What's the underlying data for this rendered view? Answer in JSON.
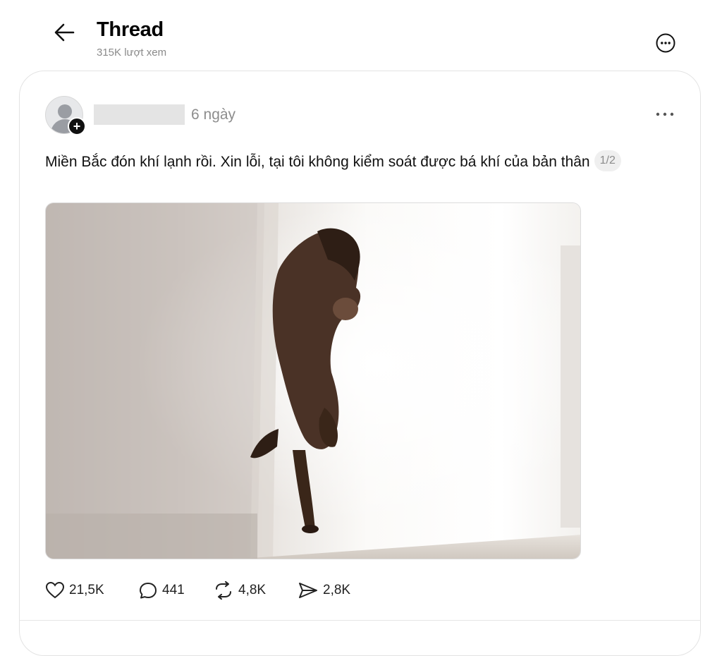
{
  "header": {
    "title": "Thread",
    "views": "315K lượt xem"
  },
  "post": {
    "time": "6 ngày",
    "text": "Miền Bắc đón khí lạnh rồi. Xin lỗi, tại tôi không kiểm soát được bá khí của bản thân",
    "page_indicator": "1/2",
    "image_description_icon": "photo",
    "actions": {
      "likes": "21,5K",
      "comments": "441",
      "reposts": "4,8K",
      "shares": "2,8K"
    }
  },
  "icons": {
    "back": "arrow-left-icon",
    "more_circle": "more-circle-icon",
    "dots": "ellipsis-icon",
    "like": "heart-icon",
    "comment": "comment-icon",
    "repost": "repost-icon",
    "share": "send-icon"
  }
}
